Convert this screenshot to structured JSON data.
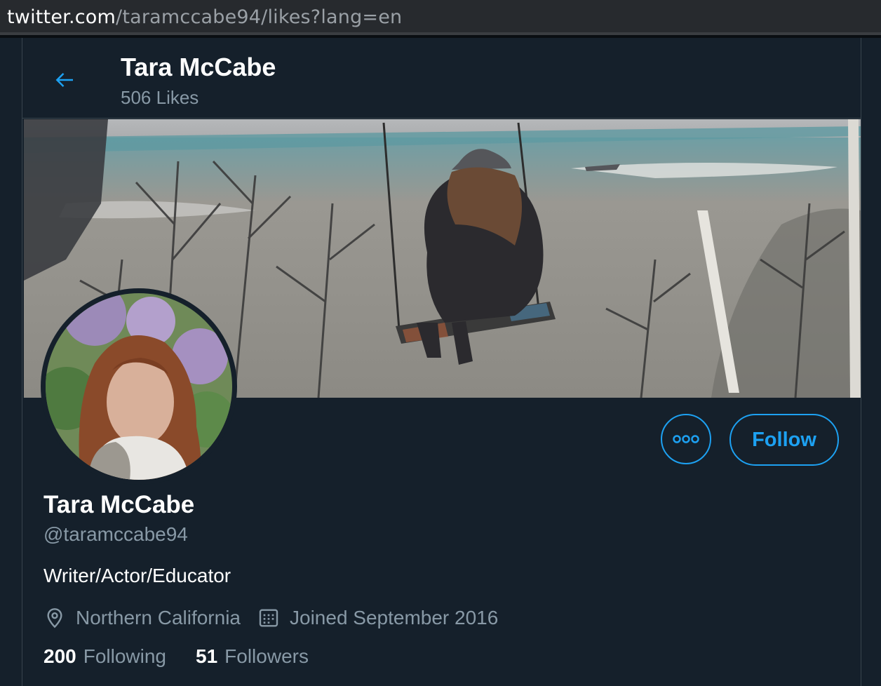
{
  "browser": {
    "url_host": "twitter.com",
    "url_path": "/taramccabe94/likes?lang=en"
  },
  "header": {
    "title": "Tara McCabe",
    "subtitle": "506 Likes",
    "back_icon": "arrow-left-icon"
  },
  "profile": {
    "name": "Tara McCabe",
    "handle": "@taramccabe94",
    "bio": "Writer/Actor/Educator",
    "location": "Northern California",
    "joined": "Joined September 2016",
    "following_count": "200",
    "following_label": "Following",
    "followers_count": "51",
    "followers_label": "Followers"
  },
  "actions": {
    "more_icon": "more-dots-icon",
    "follow_label": "Follow"
  },
  "colors": {
    "accent": "#1da1f2",
    "background": "#15202b",
    "secondary_text": "#8899a6",
    "border": "#38444d"
  }
}
